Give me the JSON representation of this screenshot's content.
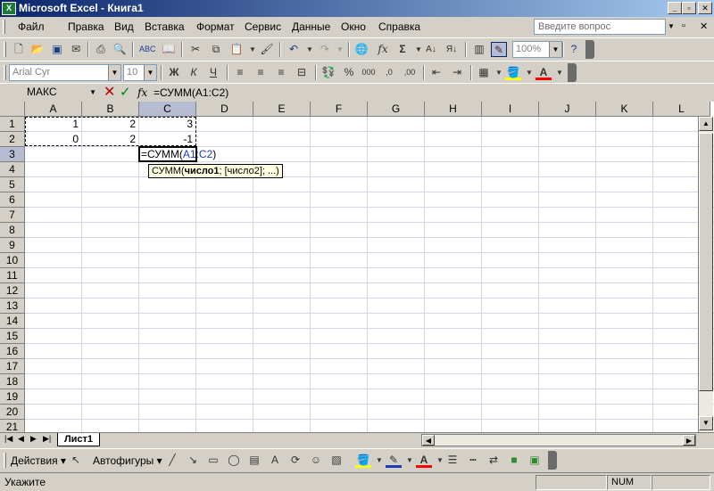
{
  "window": {
    "title": "Microsoft Excel - Книга1",
    "app_icon": "excel-icon"
  },
  "menu": {
    "items": [
      "Файл",
      "Правка",
      "Вид",
      "Вставка",
      "Формат",
      "Сервис",
      "Данные",
      "Окно",
      "Справка"
    ],
    "help_placeholder": "Введите вопрос"
  },
  "toolbar": {
    "zoom": "100%",
    "font_name": "Arial Cyr",
    "font_size": "10"
  },
  "formula_bar": {
    "name_box": "МАКС",
    "fx": "fx",
    "content": "=СУММ(A1:C2)"
  },
  "columns": [
    "A",
    "B",
    "C",
    "D",
    "E",
    "F",
    "G",
    "H",
    "I",
    "J",
    "K",
    "L"
  ],
  "rows": [
    "1",
    "2",
    "3",
    "4",
    "5",
    "6",
    "7",
    "8",
    "9",
    "10",
    "11",
    "12",
    "13",
    "14",
    "15",
    "16",
    "17",
    "18",
    "19",
    "20",
    "21"
  ],
  "cells": {
    "A1": "1",
    "B1": "2",
    "C1": "3",
    "A2": "0",
    "B2": "2",
    "C2": "-1"
  },
  "editing": {
    "prefix": "=СУММ(",
    "ref": "A1:C2",
    "suffix": ")"
  },
  "tooltip": {
    "func": "СУММ(",
    "arg1": "число1",
    "rest": "; [число2]; ...)"
  },
  "sheet": {
    "tab": "Лист1"
  },
  "drawing": {
    "actions": "Действия",
    "autoshapes": "Автофигуры"
  },
  "status": {
    "mode": "Укажите",
    "num": "NUM"
  }
}
